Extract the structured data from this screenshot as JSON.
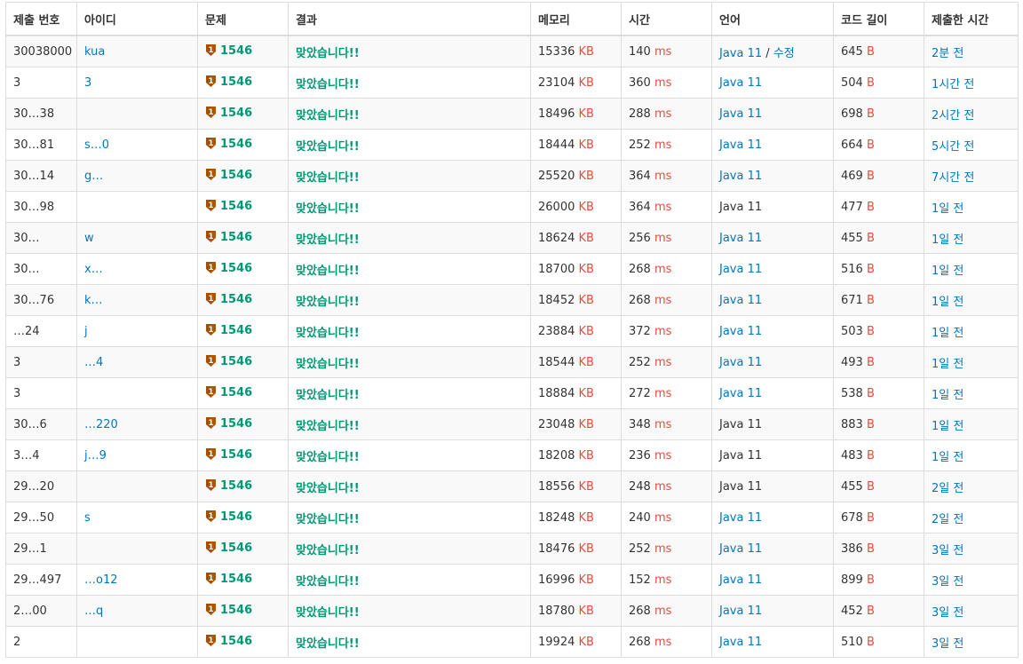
{
  "headers": [
    "제출 번호",
    "아이디",
    "문제",
    "결과",
    "메모리",
    "시간",
    "언어",
    "코드 길이",
    "제출한 시간"
  ],
  "units": {
    "memory": "KB",
    "time": "ms",
    "code": "B"
  },
  "problem_id": "1546",
  "result_text": "맞았습니다!!",
  "tier_icon": "bronze-tier-1-icon",
  "edit_label": "수정",
  "colors": {
    "link": "#0076c0",
    "unit": "#e74c3c",
    "accepted": "#009874",
    "tier": "#ad5600"
  },
  "rows": [
    {
      "id": "30038000",
      "user": "kua",
      "memory": "15336",
      "time": "140",
      "lang": "Java 11",
      "lang_link": true,
      "editable": true,
      "code": "645",
      "when": "2분 전"
    },
    {
      "id": "3",
      "user": "3",
      "memory": "23104",
      "time": "360",
      "lang": "Java 11",
      "lang_link": true,
      "editable": false,
      "code": "504",
      "when": "1시간 전"
    },
    {
      "id": "30…38",
      "user": "",
      "memory": "18496",
      "time": "288",
      "lang": "Java 11",
      "lang_link": true,
      "editable": false,
      "code": "698",
      "when": "2시간 전"
    },
    {
      "id": "30…81",
      "user": "s…0",
      "memory": "18444",
      "time": "252",
      "lang": "Java 11",
      "lang_link": true,
      "editable": false,
      "code": "664",
      "when": "5시간 전"
    },
    {
      "id": "30…14",
      "user": "g…",
      "memory": "25520",
      "time": "364",
      "lang": "Java 11",
      "lang_link": true,
      "editable": false,
      "code": "469",
      "when": "7시간 전"
    },
    {
      "id": "30…98",
      "user": "",
      "memory": "26000",
      "time": "364",
      "lang": "Java 11",
      "lang_link": false,
      "editable": false,
      "code": "477",
      "when": "1일 전"
    },
    {
      "id": "30…",
      "user": "w",
      "memory": "18624",
      "time": "256",
      "lang": "Java 11",
      "lang_link": true,
      "editable": false,
      "code": "455",
      "when": "1일 전"
    },
    {
      "id": "30…",
      "user": "x…",
      "memory": "18700",
      "time": "268",
      "lang": "Java 11",
      "lang_link": true,
      "editable": false,
      "code": "516",
      "when": "1일 전"
    },
    {
      "id": "30…76",
      "user": "k…",
      "memory": "18452",
      "time": "268",
      "lang": "Java 11",
      "lang_link": true,
      "editable": false,
      "code": "671",
      "when": "1일 전"
    },
    {
      "id": "…24",
      "user": "j",
      "memory": "23884",
      "time": "372",
      "lang": "Java 11",
      "lang_link": true,
      "editable": false,
      "code": "503",
      "when": "1일 전"
    },
    {
      "id": "3",
      "user": "…4",
      "memory": "18544",
      "time": "252",
      "lang": "Java 11",
      "lang_link": true,
      "editable": false,
      "code": "493",
      "when": "1일 전"
    },
    {
      "id": "3",
      "user": "",
      "memory": "18884",
      "time": "272",
      "lang": "Java 11",
      "lang_link": true,
      "editable": false,
      "code": "538",
      "when": "1일 전"
    },
    {
      "id": "30…6",
      "user": "…220",
      "memory": "23048",
      "time": "348",
      "lang": "Java 11",
      "lang_link": false,
      "editable": false,
      "code": "883",
      "when": "1일 전"
    },
    {
      "id": "3…4",
      "user": "j…9",
      "memory": "18208",
      "time": "236",
      "lang": "Java 11",
      "lang_link": false,
      "editable": false,
      "code": "483",
      "when": "1일 전"
    },
    {
      "id": "29…20",
      "user": "",
      "memory": "18556",
      "time": "248",
      "lang": "Java 11",
      "lang_link": false,
      "editable": false,
      "code": "455",
      "when": "2일 전"
    },
    {
      "id": "29…50",
      "user": "s",
      "memory": "18248",
      "time": "240",
      "lang": "Java 11",
      "lang_link": true,
      "editable": false,
      "code": "678",
      "when": "2일 전"
    },
    {
      "id": "29…1",
      "user": "",
      "memory": "18476",
      "time": "252",
      "lang": "Java 11",
      "lang_link": true,
      "editable": false,
      "code": "386",
      "when": "3일 전"
    },
    {
      "id": "29…497",
      "user": "…o12",
      "memory": "16996",
      "time": "152",
      "lang": "Java 11",
      "lang_link": true,
      "editable": false,
      "code": "899",
      "when": "3일 전"
    },
    {
      "id": "2…00",
      "user": "…q",
      "memory": "18780",
      "time": "268",
      "lang": "Java 11",
      "lang_link": true,
      "editable": false,
      "code": "452",
      "when": "3일 전"
    },
    {
      "id": "2",
      "user": "",
      "memory": "19924",
      "time": "268",
      "lang": "Java 11",
      "lang_link": true,
      "editable": false,
      "code": "510",
      "when": "3일 전"
    }
  ]
}
